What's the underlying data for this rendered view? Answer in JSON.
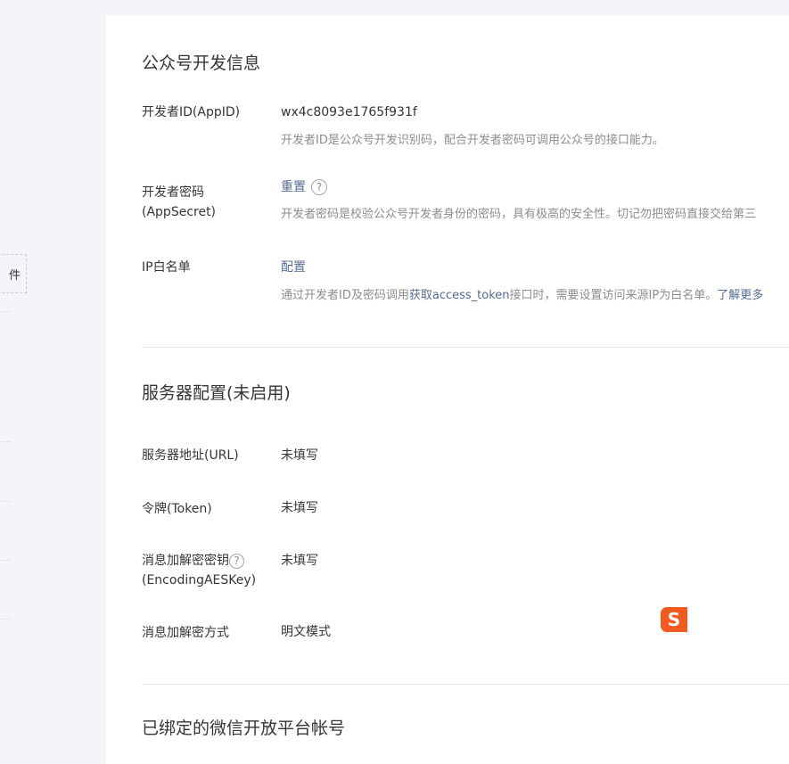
{
  "left_strip": {
    "plugin_label": "件"
  },
  "developer_info": {
    "title": "公众号开发信息",
    "appid": {
      "label": "开发者ID(AppID)",
      "value": "wx4c8093e1765f931f",
      "desc": "开发者ID是公众号开发识别码，配合开发者密码可调用公众号的接口能力。"
    },
    "appsecret": {
      "label_line1": "开发者密码",
      "label_line2": "(AppSecret)",
      "action": "重置",
      "help_icon": "?",
      "desc": "开发者密码是校验公众号开发者身份的密码，具有极高的安全性。切记勿把密码直接交给第三"
    },
    "ip_whitelist": {
      "label": "IP白名单",
      "action": "配置",
      "desc_prefix": "通过开发者ID及密码调用",
      "desc_link": "获取access_token",
      "desc_suffix": "接口时，需要设置访问来源IP为白名单。",
      "learn_more": "了解更多"
    }
  },
  "server_config": {
    "title": "服务器配置(未启用)",
    "url": {
      "label": "服务器地址(URL)",
      "value": "未填写"
    },
    "token": {
      "label": "令牌(Token)",
      "value": "未填写"
    },
    "aes_key": {
      "label_line1": "消息加解密密钥",
      "label_line2": "(EncodingAESKey)",
      "help_icon": "?",
      "value": "未填写"
    },
    "encrypt_mode": {
      "label": "消息加解密方式",
      "value": "明文模式"
    }
  },
  "open_platform": {
    "title": "已绑定的微信开放平台帐号"
  },
  "floating_icon": {
    "name": "sogou-input-icon",
    "letter": "S",
    "color": "#f25b1f"
  }
}
